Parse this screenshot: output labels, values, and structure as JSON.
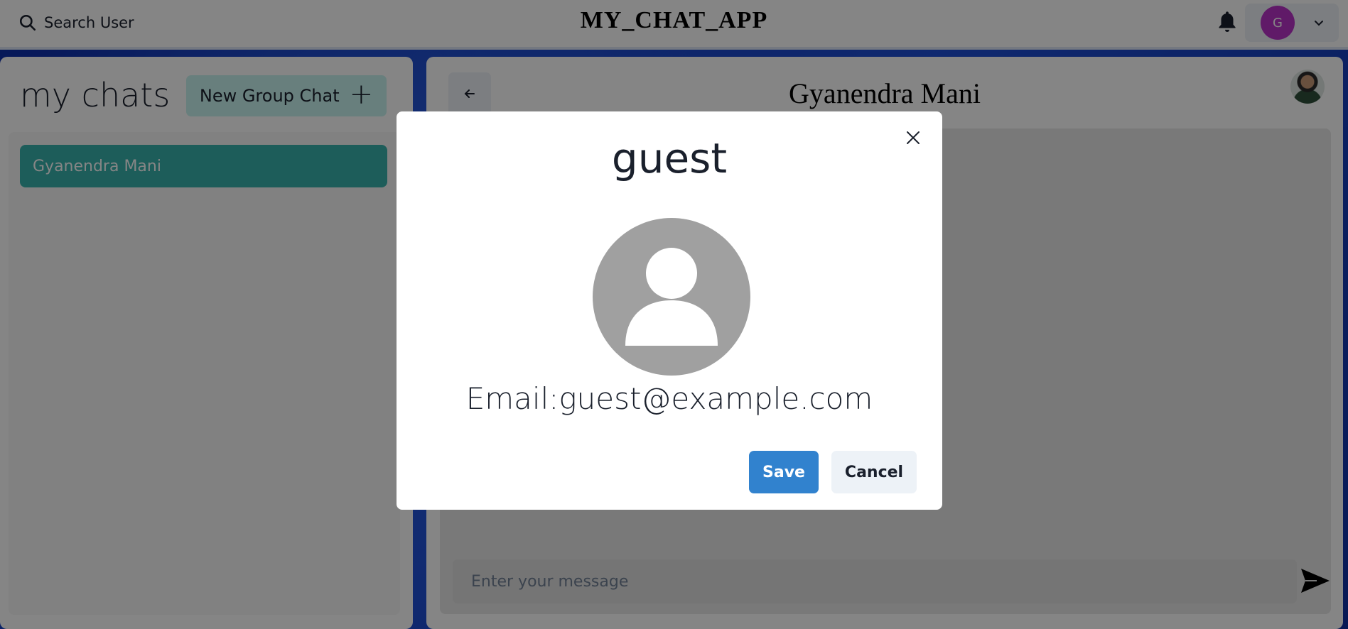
{
  "header": {
    "search_label": "Search User",
    "app_title": "MY_CHAT_APP",
    "user_initial": "G",
    "user_avatar_color": "#b832c8"
  },
  "sidebar": {
    "title": "my chats",
    "new_group_label": "New Group Chat",
    "chats": [
      {
        "name": "Gyanendra Mani",
        "selected": true
      }
    ]
  },
  "chat": {
    "title": "Gyanendra Mani",
    "input_placeholder": "Enter your message"
  },
  "modal": {
    "title": "guest",
    "email_line": "Email:guest@example.com",
    "save_label": "Save",
    "cancel_label": "Cancel"
  },
  "colors": {
    "accent_teal": "#38b2ac",
    "primary_blue": "#3182ce",
    "new_group_bg": "#c7f4ef"
  },
  "icons": {
    "search": "search-icon",
    "bell": "bell-icon",
    "chevron": "chevron-down-icon",
    "back": "arrow-left-icon",
    "send": "send-icon",
    "close": "close-icon",
    "avatar_placeholder": "user-placeholder-icon"
  }
}
